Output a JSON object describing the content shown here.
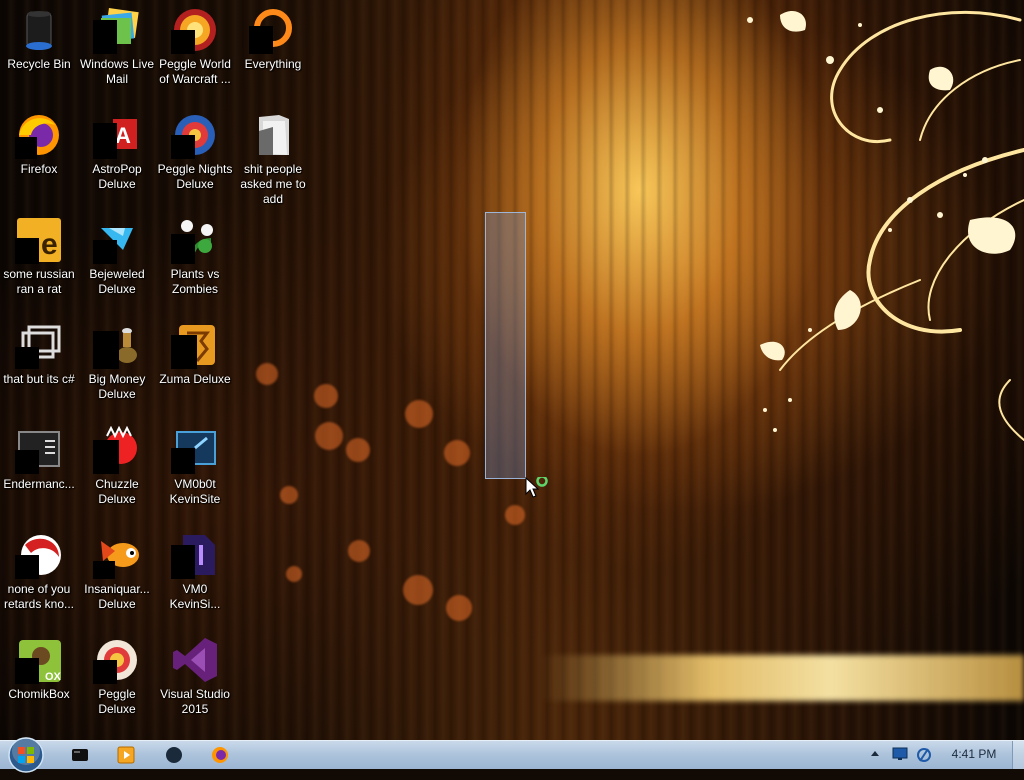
{
  "desktop": {
    "icons": [
      {
        "label": "Recycle Bin",
        "icon": "recycle-bin-icon"
      },
      {
        "label": "Windows Live Mail",
        "icon": "windows-live-mail-icon"
      },
      {
        "label": "Peggle World of Warcraft ...",
        "icon": "peggle-wow-icon"
      },
      {
        "label": "Everything",
        "icon": "everything-search-icon"
      },
      {
        "label": "Firefox",
        "icon": "firefox-icon"
      },
      {
        "label": "AstroPop Deluxe",
        "icon": "astropop-icon"
      },
      {
        "label": "Peggle Nights Deluxe",
        "icon": "peggle-nights-icon"
      },
      {
        "label": "shit people asked me to add",
        "icon": "folder-icon"
      },
      {
        "label": "some russian ran a rat",
        "icon": "executable-icon"
      },
      {
        "label": "Bejeweled Deluxe",
        "icon": "bejeweled-icon"
      },
      {
        "label": "Plants vs Zombies",
        "icon": "plants-vs-zombies-icon"
      },
      {
        "label": "that but its c#",
        "icon": "shortcut-icon"
      },
      {
        "label": "Big Money Deluxe",
        "icon": "big-money-icon"
      },
      {
        "label": "Zuma Deluxe",
        "icon": "zuma-icon"
      },
      {
        "label": "Endermanc...",
        "icon": "app-window-icon"
      },
      {
        "label": "Chuzzle Deluxe",
        "icon": "chuzzle-icon"
      },
      {
        "label": "VM0b0t KevinSite",
        "icon": "vm-app-icon"
      },
      {
        "label": "none of you retards kno...",
        "icon": "red-app-icon"
      },
      {
        "label": "Insaniquar... Deluxe",
        "icon": "insaniquarium-icon"
      },
      {
        "label": "VM0 KevinSi...",
        "icon": "file-icon"
      },
      {
        "label": "ChomikBox",
        "icon": "chomikbox-icon"
      },
      {
        "label": "Peggle Deluxe",
        "icon": "peggle-icon"
      },
      {
        "label": "Visual Studio 2015",
        "icon": "visual-studio-icon"
      }
    ]
  },
  "taskbar": {
    "start_button": "windows-start-orb-icon",
    "pinned": [
      "cmd-icon",
      "media-player-icon",
      "app-icon",
      "firefox-icon"
    ],
    "tray": {
      "clock": "4:41 PM",
      "icons": [
        "show-hidden-icons-arrow",
        "monitor-icon",
        "network-icon"
      ]
    }
  },
  "colors": {
    "taskbar": "#aec4dc",
    "selection": "#7896c8",
    "wallpaper_gold": "#ffce5c"
  }
}
